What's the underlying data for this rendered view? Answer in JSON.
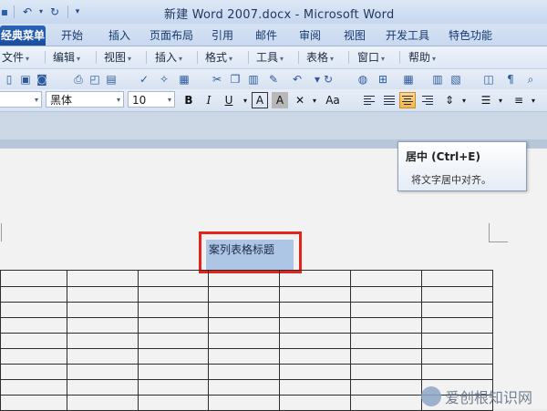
{
  "window": {
    "title": "新建 Word 2007.docx - Microsoft Word"
  },
  "quick_access": {
    "undo_icon": "undo-icon",
    "redo_icon": "redo-icon",
    "customize_icon": "customize-qat-icon"
  },
  "ribbon_tabs": [
    {
      "label": "经典菜单",
      "active": true
    },
    {
      "label": "开始",
      "active": false
    },
    {
      "label": "插入",
      "active": false
    },
    {
      "label": "页面布局",
      "active": false
    },
    {
      "label": "引用",
      "active": false
    },
    {
      "label": "邮件",
      "active": false
    },
    {
      "label": "审阅",
      "active": false
    },
    {
      "label": "视图",
      "active": false
    },
    {
      "label": "开发工具",
      "active": false
    },
    {
      "label": "特色功能",
      "active": false
    }
  ],
  "menus": [
    {
      "label": "文件"
    },
    {
      "label": "编辑"
    },
    {
      "label": "视图"
    },
    {
      "label": "插入"
    },
    {
      "label": "格式"
    },
    {
      "label": "工具"
    },
    {
      "label": "表格"
    },
    {
      "label": "窗口"
    },
    {
      "label": "帮助"
    }
  ],
  "format_bar": {
    "font_name": "黑体",
    "font_size": "10",
    "bold_label": "B",
    "italic_label": "I",
    "underline_label": "U",
    "char_border_label": "A",
    "char_shading_label": "A",
    "font_case_label": "Aa"
  },
  "tooltip": {
    "title": "居中 (Ctrl+E)",
    "description": "将文字居中对齐。"
  },
  "document": {
    "heading": "案列表格标题",
    "table_rows": 9,
    "table_cols": 7
  },
  "watermark": {
    "text": "爱创根知识网"
  },
  "colors": {
    "active_tab": "#1a4d9d",
    "highlight_box": "#e3261c",
    "selection": "#adc6e6",
    "active_button": "#f6b54a"
  }
}
